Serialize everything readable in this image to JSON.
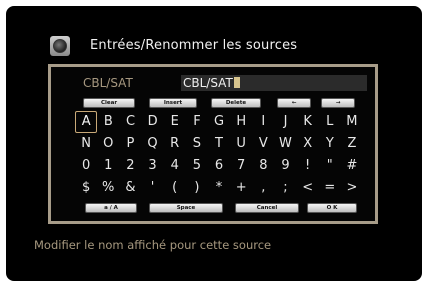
{
  "header": {
    "title": "Entrées/Renommer les sources",
    "icon": "source-icon"
  },
  "editor": {
    "source_label": "CBL/SAT",
    "name_value": "CBL/SAT",
    "accent_color": "#c9a978"
  },
  "top_buttons": {
    "clear": "Clear",
    "insert": "Insert",
    "delete": "Delete",
    "left": "←",
    "right": "→"
  },
  "keyboard": {
    "rows": [
      [
        "A",
        "B",
        "C",
        "D",
        "E",
        "F",
        "G",
        "H",
        "I",
        "J",
        "K",
        "L",
        "M"
      ],
      [
        "N",
        "O",
        "P",
        "Q",
        "R",
        "S",
        "T",
        "U",
        "V",
        "W",
        "X",
        "Y",
        "Z"
      ],
      [
        "0",
        "1",
        "2",
        "3",
        "4",
        "5",
        "6",
        "7",
        "8",
        "9",
        "!",
        "\"",
        "#"
      ],
      [
        "$",
        "%",
        "&",
        "'",
        "(",
        ")",
        "*",
        "+",
        ",",
        ";",
        "<",
        "=",
        ">"
      ]
    ],
    "selected": "A"
  },
  "bottom_buttons": {
    "case": "a / A",
    "space": "Space",
    "cancel": "Cancel",
    "ok": "O K"
  },
  "hint": "Modifier le nom affiché pour cette source"
}
